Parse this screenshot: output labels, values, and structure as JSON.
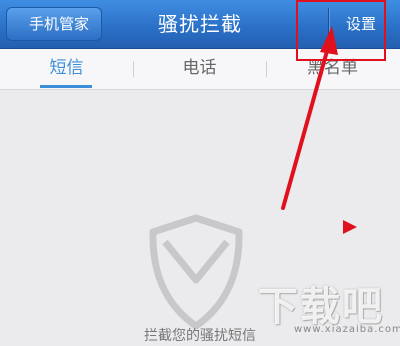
{
  "header": {
    "back_label": "手机管家",
    "title": "骚扰拦截",
    "settings_label": "设置"
  },
  "tabs": [
    {
      "label": "短信",
      "active": true
    },
    {
      "label": "电话",
      "active": false
    },
    {
      "label": "黑名单",
      "active": false
    }
  ],
  "main": {
    "empty_icon": "shield-icon",
    "empty_text": "拦截您的骚扰短信"
  },
  "watermark": {
    "text": "下载吧",
    "url": "www.xiazaiba.com"
  },
  "colors": {
    "header_blue": "#2a6fc6",
    "tab_active": "#3d8ed9",
    "annotation_red": "#e0111c",
    "background": "#ebebee"
  }
}
